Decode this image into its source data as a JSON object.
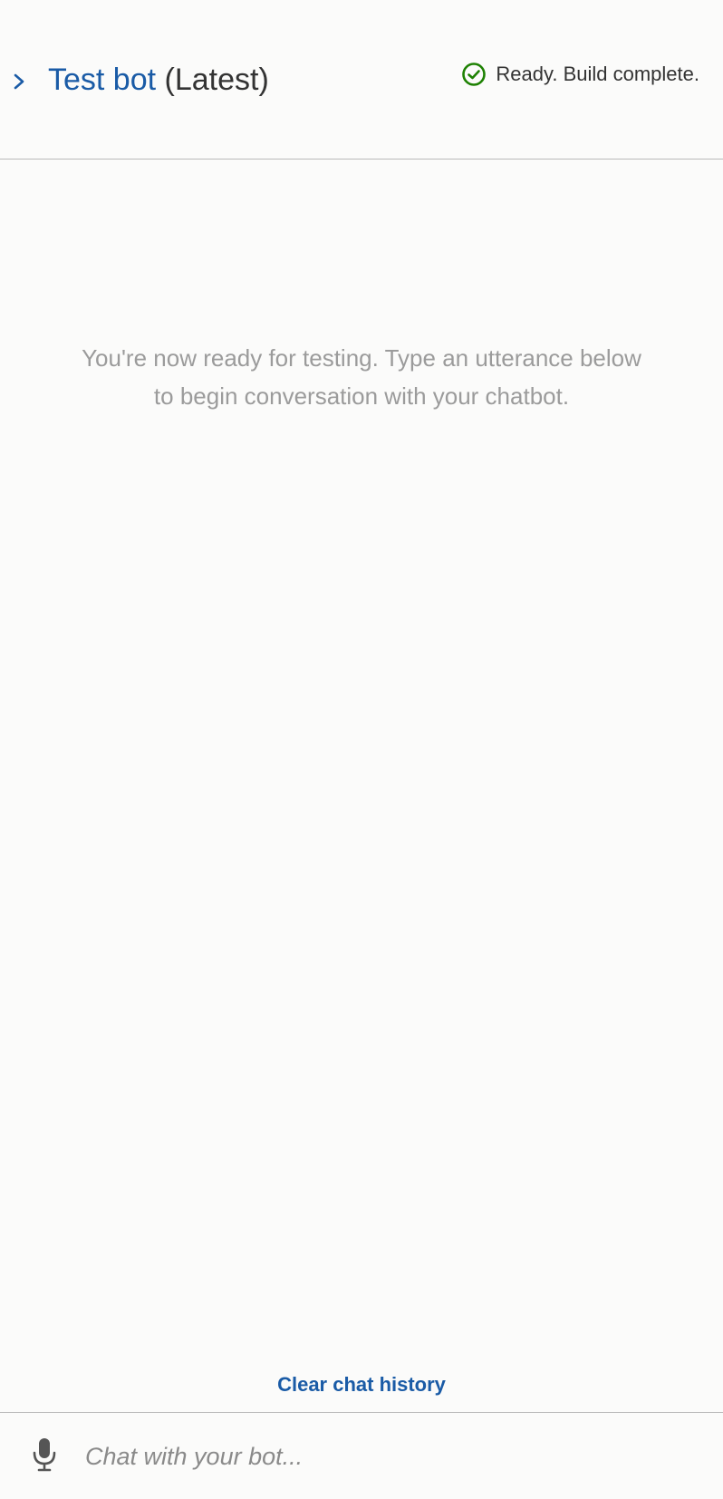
{
  "header": {
    "bot_name": "Test bot",
    "version_label": " (Latest)",
    "status_text": "Ready. Build complete.",
    "toggle_icon": "chevron-right-icon",
    "status_icon": "check-circle-icon"
  },
  "conversation": {
    "empty_message": "You're now ready for testing. Type an utterance below to begin conversation with your chatbot."
  },
  "actions": {
    "clear_history_label": "Clear chat history"
  },
  "input": {
    "placeholder": "Chat with your bot...",
    "value": "",
    "mic_icon": "microphone-icon"
  },
  "colors": {
    "link_blue": "#1a5ba6",
    "status_green": "#1d8102",
    "muted_text": "#9b9b9b",
    "background": "#fbfbfa"
  }
}
